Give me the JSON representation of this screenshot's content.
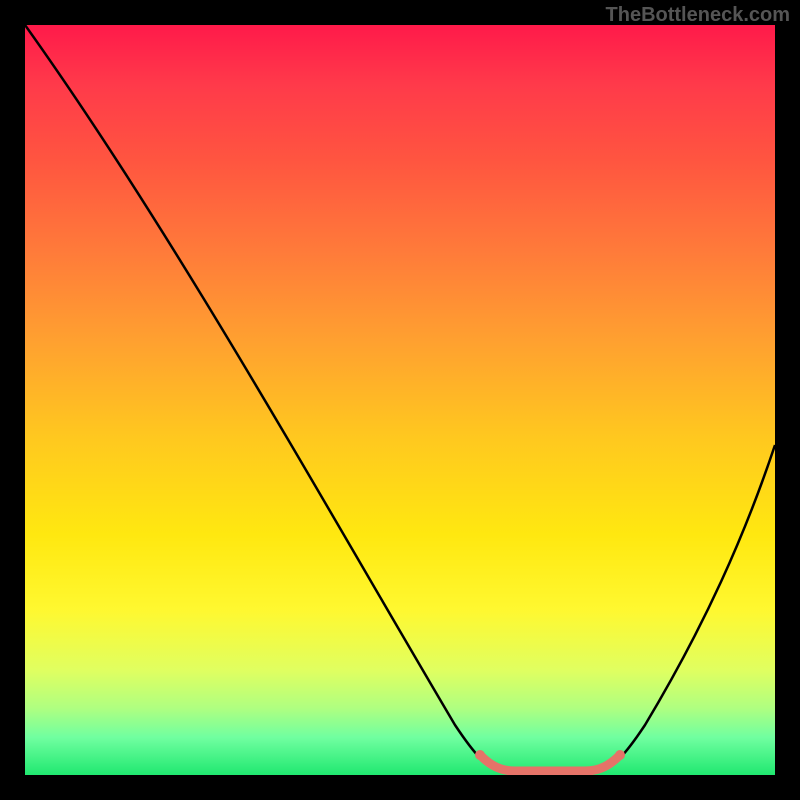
{
  "watermark": "TheBottleneck.com",
  "chart_data": {
    "type": "line",
    "title": "",
    "xlabel": "",
    "ylabel": "",
    "x": [
      0,
      5,
      10,
      15,
      20,
      25,
      30,
      35,
      40,
      45,
      50,
      55,
      60,
      62,
      66,
      70,
      74,
      78,
      80,
      85,
      90,
      95,
      100
    ],
    "values": [
      100,
      92,
      84,
      76,
      68,
      60,
      52,
      44,
      36,
      28,
      20,
      12,
      5,
      1,
      0,
      0,
      0,
      1,
      5,
      13,
      23,
      34,
      45
    ],
    "xlim": [
      0,
      100
    ],
    "ylim": [
      0,
      100
    ],
    "gradient_stops": [
      {
        "pos": 0,
        "color": "#ff1a4a"
      },
      {
        "pos": 50,
        "color": "#ffc820"
      },
      {
        "pos": 80,
        "color": "#fff830"
      },
      {
        "pos": 100,
        "color": "#20e870"
      }
    ],
    "valley_marker": {
      "x_range": [
        62,
        78
      ],
      "color": "#e57368"
    }
  }
}
